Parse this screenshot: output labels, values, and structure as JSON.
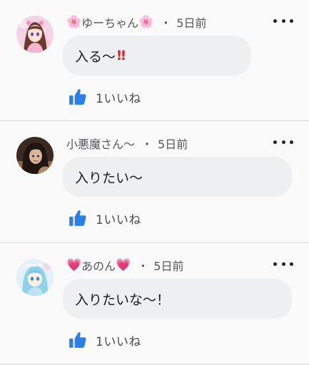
{
  "colors": {
    "background": "#fafafb",
    "bubble": "#eeeff1",
    "like_blue": "#2d7fe8",
    "divider": "#d9d9dd"
  },
  "comments": [
    {
      "prefix_emoji": "🌸",
      "suffix_emoji": "🌸",
      "username": "ゆーちゃん",
      "separator": "・",
      "time": "5日前",
      "text": "入る〜",
      "emphasis": "‼",
      "likes": "1いいね",
      "avatar_icon": "avatar-anime-girl-pink"
    },
    {
      "prefix_emoji": "",
      "suffix_emoji": "",
      "username": "小悪魔さん〜",
      "separator": "・",
      "time": "5日前",
      "text": "入りたい〜",
      "emphasis": "",
      "likes": "1いいね",
      "avatar_icon": "avatar-photo-dark"
    },
    {
      "prefix_emoji": "💗",
      "suffix_emoji": "💗",
      "username": "あのん",
      "separator": "・",
      "time": "5日前",
      "text": "入りたいな〜！",
      "emphasis": "",
      "likes": "1いいね",
      "avatar_icon": "avatar-anime-blue"
    }
  ]
}
